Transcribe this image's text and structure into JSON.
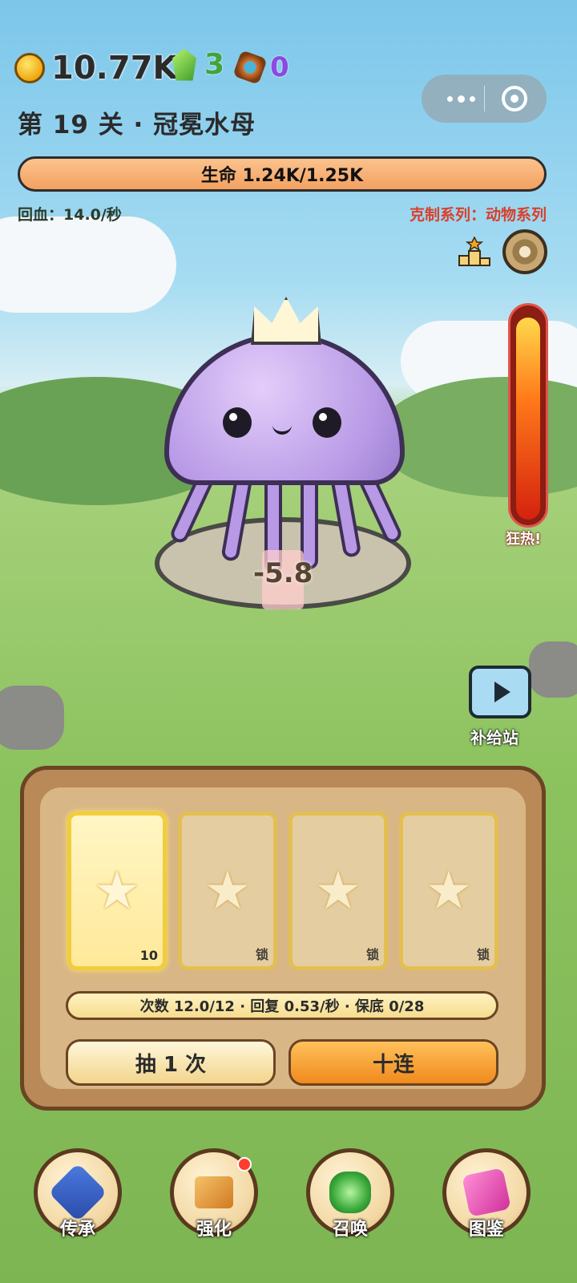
{
  "resources": {
    "coins": "10.77K",
    "gems": "3",
    "runes": "0",
    "colors": {
      "coins": "#2b2b2b",
      "gems": "#3fa53a",
      "runes": "#8b4ae0"
    }
  },
  "level": {
    "title": "第 19 关 · 冠冕水母"
  },
  "boss": {
    "hp_text": "生命 1.24K/1.25K",
    "hp_fraction": 0.992,
    "regen_text": "回血：14.0/秒",
    "counter_text": "克制系列：动物系列",
    "damage_popup": "-5.8"
  },
  "rage": {
    "label": "狂热!",
    "fill_fraction": 0.97
  },
  "supply": {
    "label": "补给站",
    "icon": "play-icon"
  },
  "cards": [
    {
      "tag": "10",
      "state": "active",
      "icon": "star-icon"
    },
    {
      "tag": "锁",
      "state": "locked",
      "icon": "star-icon"
    },
    {
      "tag": "锁",
      "state": "locked",
      "icon": "star-icon"
    },
    {
      "tag": "锁",
      "state": "locked",
      "icon": "star-icon"
    }
  ],
  "draw_panel": {
    "status_text": "次数 12.0/12 · 回复 0.53/秒 · 保底 0/28",
    "draw_one_label": "抽 1 次",
    "draw_ten_label": "十连"
  },
  "nav": [
    {
      "label": "传承",
      "icon": "scroll-gem-icon"
    },
    {
      "label": "强化",
      "icon": "hammer-icon",
      "badge": true
    },
    {
      "label": "召唤",
      "icon": "summon-crystal-icon"
    },
    {
      "label": "图鉴",
      "icon": "book-icon"
    }
  ],
  "accent_colors": {
    "panel_wood": "#b98a57",
    "hp_bar": "#f3a160",
    "rage": "#d5220f"
  }
}
